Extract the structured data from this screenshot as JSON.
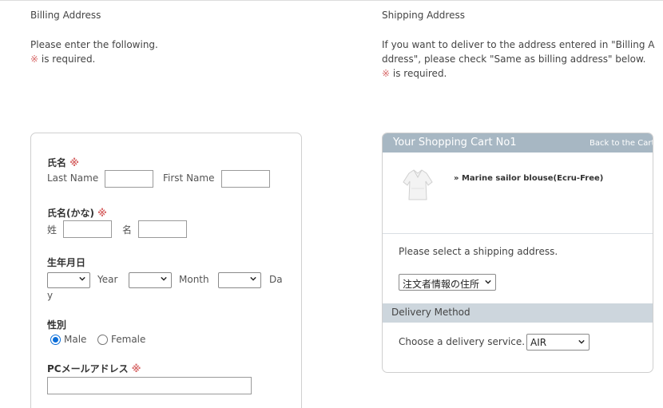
{
  "billing": {
    "heading": "Billing Address",
    "intro_line1": "Please enter the following.",
    "required_mark": "※",
    "required_text": " is required.",
    "fields": {
      "name_label": "氏名",
      "last_name_label": "Last Name",
      "first_name_label": "First Name",
      "kana_label": "氏名(かな)",
      "sei_label": "姓",
      "mei_label": "名",
      "birth_label": "生年月日",
      "year_label": "Year",
      "month_label": "Month",
      "day_label_a": "Da",
      "day_label_b": "y",
      "gender_label": "性別",
      "male_label": "Male",
      "female_label": "Female",
      "gender_selected": "Male",
      "email_label": "PCメールアドレス"
    }
  },
  "shipping": {
    "heading": "Shipping Address",
    "intro_line1": "If you want to deliver to the address entered in \"Billing A",
    "intro_line2": "ddress\", please check \"Same as billing address\" below.",
    "required_mark": "※",
    "required_text": " is required."
  },
  "cart": {
    "title": "Your Shopping Cart No1",
    "back_link": "Back to the Cart",
    "product_prefix": "»",
    "product_name": "Marine sailor blouse(Ecru-Free)",
    "select_prompt": "Please select a shipping address.",
    "address_selected": "注文者情報の住所",
    "delivery_heading": "Delivery Method",
    "delivery_prompt": "Choose a delivery service.",
    "delivery_selected": "AIR"
  },
  "colors": {
    "required": "#d86b6b",
    "cart_header": "#a7b7c3",
    "radio_selected": "#0a6dd8"
  }
}
